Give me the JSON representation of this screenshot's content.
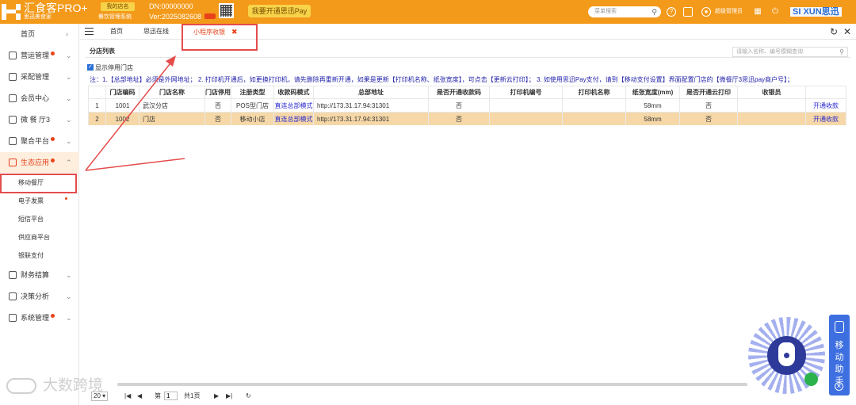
{
  "header": {
    "brand": "汇食客PRO+",
    "brand_sub": "思迅美食家",
    "store_badge": "我的店名",
    "store_sub": "餐饮管理系统",
    "dn": "DN:00000000",
    "version": "Ver:2025082608",
    "pay_button": "我要开通思迅Pay",
    "search_placeholder": "菜单搜索",
    "user_name": "超级管理员",
    "brand_right": "SI XUN思迅",
    "accent_color": "#f39a1a"
  },
  "sidebar": {
    "items": [
      {
        "label": "首页",
        "icon": "home"
      },
      {
        "label": "营运管理",
        "icon": "ops-icon",
        "dot": true
      },
      {
        "label": "采配管理",
        "icon": "purchase-icon"
      },
      {
        "label": "会员中心",
        "icon": "member-icon"
      },
      {
        "label": "微 餐 厅3",
        "icon": "wechat-icon"
      },
      {
        "label": "聚合平台",
        "icon": "aggregate-icon",
        "dot": true
      },
      {
        "label": "生态应用",
        "icon": "eco-icon",
        "dot": true
      }
    ],
    "sub_items": [
      {
        "label": "移动餐厅"
      },
      {
        "label": "电子发票",
        "dot": true
      },
      {
        "label": "短信平台"
      },
      {
        "label": "供应商平台"
      },
      {
        "label": "银联支付"
      }
    ],
    "bottom_items": [
      {
        "label": "财务结算",
        "icon": "finance-icon"
      },
      {
        "label": "决策分析",
        "icon": "analysis-icon"
      },
      {
        "label": "系统管理",
        "icon": "system-icon",
        "dot": true
      }
    ]
  },
  "tabs": [
    {
      "label": "首页"
    },
    {
      "label": "思迅在线"
    },
    {
      "label": "小程序收银",
      "active": true
    }
  ],
  "panel": {
    "title": "分店列表",
    "search_placeholder": "请输入名称、编号模糊查询",
    "show_disabled_label": "显示停用门店",
    "note": "注：1.【总部地址】必须是外网地址；  2. 打印机开通后，如更换打印机，请先删除再重新开通，如果是更新【打印机名称、纸张宽度】，可点击【更新云打印】；  3. 如使用思迅Pay支付，请到【移动支付设置】界面配置门店的【微餐厅3思迅pay商户号】；"
  },
  "table": {
    "columns": [
      "",
      "门店编码",
      "门店名称",
      "门店停用",
      "注册类型",
      "收款码模式",
      "总部地址",
      "是否开通收款码",
      "打印机编号",
      "打印机名称",
      "纸张宽度(mm)",
      "是否开通云打印",
      "收银员",
      ""
    ],
    "rows": [
      [
        "1",
        "1001",
        "武汉分店",
        "否",
        "POS型门店",
        "直连总部模式",
        "http://173.31.17.94:31301",
        "否",
        "",
        "",
        "58mm",
        "否",
        "",
        "开通收款"
      ],
      [
        "2",
        "1002",
        "门店",
        "否",
        "移动小店",
        "直连总部模式",
        "http://173.31.17.94:31301",
        "否",
        "",
        "",
        "58mm",
        "否",
        "",
        "开通收款"
      ]
    ]
  },
  "pager": {
    "page_size": "20",
    "page_label": "第",
    "page_value": "1",
    "total_label": "共1页"
  },
  "helper": {
    "text": "移动助手"
  },
  "watermark": "大数跨境"
}
